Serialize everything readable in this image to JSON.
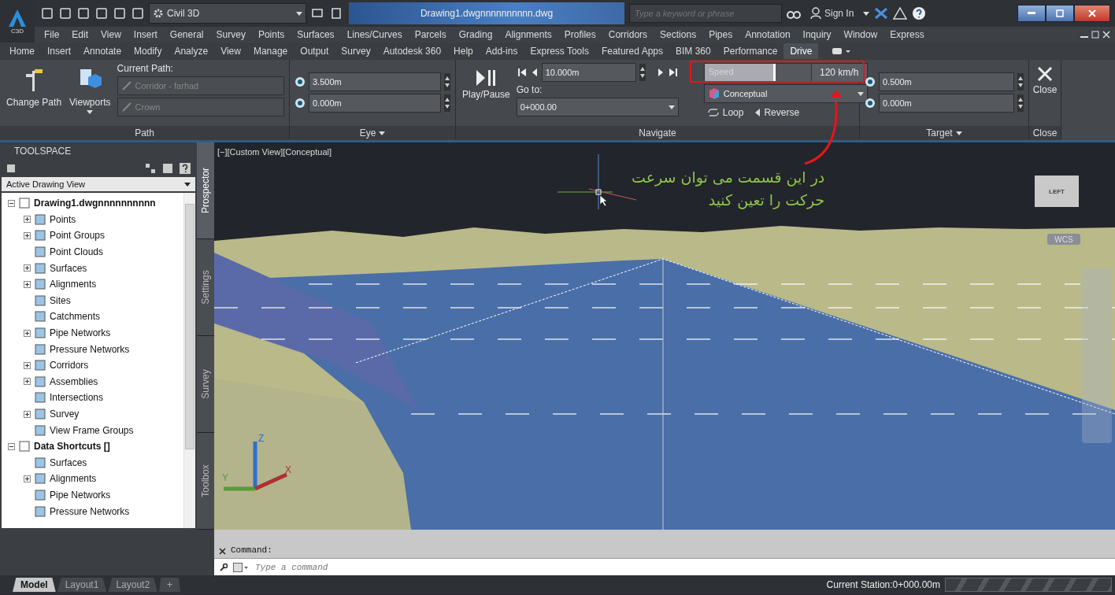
{
  "title_bar": {
    "app_label": "C3D",
    "workspace": "Civil 3D",
    "title": "Drawing1.dwgnnnnnnnnnn.dwg",
    "search": {
      "placeholder": "Type a keyword or phrase"
    },
    "sign_in": "Sign In"
  },
  "menu_bar": [
    "File",
    "Edit",
    "View",
    "Insert",
    "General",
    "Survey",
    "Points",
    "Surfaces",
    "Lines/Curves",
    "Parcels",
    "Grading",
    "Alignments",
    "Profiles",
    "Corridors",
    "Sections",
    "Pipes",
    "Annotation",
    "Inquiry",
    "Window",
    "Express"
  ],
  "ribbon_tabs": [
    {
      "label": "Home",
      "selected": false
    },
    {
      "label": "Insert",
      "selected": false
    },
    {
      "label": "Annotate",
      "selected": false
    },
    {
      "label": "Modify",
      "selected": false
    },
    {
      "label": "Analyze",
      "selected": false
    },
    {
      "label": "View",
      "selected": false
    },
    {
      "label": "Manage",
      "selected": false
    },
    {
      "label": "Output",
      "selected": false
    },
    {
      "label": "Survey",
      "selected": false
    },
    {
      "label": "Autodesk 360",
      "selected": false
    },
    {
      "label": "Help",
      "selected": false
    },
    {
      "label": "Add-ins",
      "selected": false
    },
    {
      "label": "Express Tools",
      "selected": false
    },
    {
      "label": "Featured Apps",
      "selected": false
    },
    {
      "label": "BIM 360",
      "selected": false
    },
    {
      "label": "Performance",
      "selected": false
    },
    {
      "label": "Drive",
      "selected": true
    }
  ],
  "ribbon": {
    "path": {
      "title": "Path",
      "change_path": "Change Path",
      "viewports": "Viewports",
      "current_path_label": "Current Path:",
      "fields": [
        "Corridor - farhad",
        "Crown"
      ]
    },
    "eye": {
      "title": "Eye",
      "fields": [
        "3.500m",
        "0.000m"
      ]
    },
    "navigate": {
      "title": "Navigate",
      "play_pause": "Play/Pause",
      "goto_label": "Go to:",
      "goto_value": "0+000.00",
      "step": "10.000m",
      "speed": {
        "label": "Speed",
        "level": 0.67,
        "reading": "120 km/h"
      },
      "visual_style": "Conceptual",
      "loop": "Loop",
      "reverse": "Reverse"
    },
    "target": {
      "title": "Target",
      "fields": [
        "0.500m",
        "0.000m"
      ]
    },
    "close": {
      "title": "Close",
      "button": "Close"
    }
  },
  "toolspace": {
    "title": "TOOLSPACE",
    "view": "Active Drawing View",
    "tree": [
      {
        "label": "Drawing1.dwgnnnnnnnnnn",
        "kind": "group",
        "expanded": true,
        "children": [
          {
            "label": "Points",
            "kind": "group",
            "expanded": false
          },
          {
            "label": "Point Groups",
            "kind": "group",
            "expanded": false
          },
          {
            "label": "Point Clouds",
            "kind": "leaf"
          },
          {
            "label": "Surfaces",
            "kind": "group",
            "expanded": false
          },
          {
            "label": "Alignments",
            "kind": "group",
            "expanded": false
          },
          {
            "label": "Sites",
            "kind": "leaf"
          },
          {
            "label": "Catchments",
            "kind": "leaf"
          },
          {
            "label": "Pipe Networks",
            "kind": "group",
            "expanded": false
          },
          {
            "label": "Pressure Networks",
            "kind": "leaf"
          },
          {
            "label": "Corridors",
            "kind": "group",
            "expanded": false
          },
          {
            "label": "Assemblies",
            "kind": "group",
            "expanded": false
          },
          {
            "label": "Intersections",
            "kind": "leaf"
          },
          {
            "label": "Survey",
            "kind": "group",
            "expanded": false
          },
          {
            "label": "View Frame Groups",
            "kind": "leaf"
          }
        ]
      },
      {
        "label": "Data Shortcuts []",
        "kind": "group",
        "expanded": true,
        "children": [
          {
            "label": "Surfaces",
            "kind": "leaf"
          },
          {
            "label": "Alignments",
            "kind": "group",
            "expanded": false
          },
          {
            "label": "Pipe Networks",
            "kind": "leaf"
          },
          {
            "label": "Pressure Networks",
            "kind": "leaf"
          }
        ]
      }
    ],
    "side_tabs": [
      {
        "label": "Prospector",
        "selected": true
      },
      {
        "label": "Settings",
        "selected": false
      },
      {
        "label": "Survey",
        "selected": false
      },
      {
        "label": "Toolbox",
        "selected": false
      }
    ]
  },
  "viewport": {
    "label": "[−][Custom View][Conceptual]",
    "note": [
      "در این قسمت می توان سرعت",
      "حرکت را تعین کنید"
    ],
    "viewcube": "LEFT",
    "ucs": "WCS",
    "axes": [
      "Z",
      "Y",
      "X"
    ]
  },
  "command": {
    "label": "Command:",
    "placeholder": "Type a command"
  },
  "layout_tabs": [
    {
      "label": "Model",
      "selected": true
    },
    {
      "label": "Layout1",
      "selected": false
    },
    {
      "label": "Layout2",
      "selected": false
    },
    {
      "label": "+",
      "selected": false
    }
  ],
  "status_bar": {
    "station": "Current Station:0+000.00m"
  }
}
